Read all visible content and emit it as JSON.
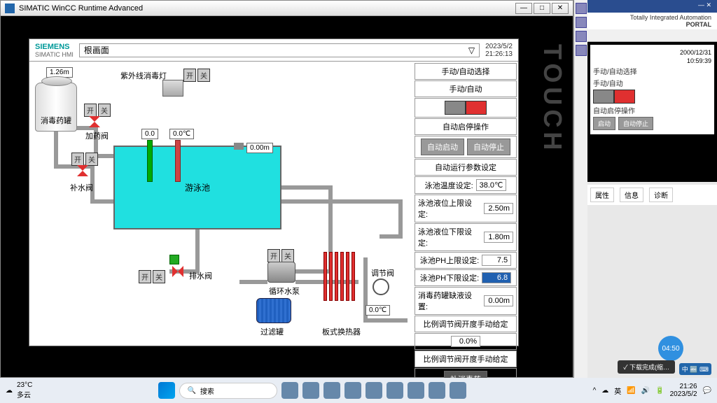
{
  "window": {
    "title": "SIMATIC WinCC Runtime Advanced"
  },
  "tia": {
    "title": "Totally Integrated Automation",
    "sub": "PORTAL",
    "date": "2000/12/31",
    "time": "10:59:39",
    "sel": "手动/自动选择",
    "mode": "手动/自动",
    "ops": "自动启停操作",
    "start": "启动",
    "stop": "自动停止",
    "tabs": {
      "prop": "属性",
      "info": "信息",
      "diag": "诊断"
    }
  },
  "hmi": {
    "brand": "SIEMENS",
    "sub": "SIMATIC HMI",
    "root": "根画面",
    "date": "2023/5/2",
    "time": "21:26:13"
  },
  "scada": {
    "tank_level": "1.26m",
    "tank_label": "消毒药罐",
    "uv": "紫外线消毒灯",
    "on": "开",
    "off": "关",
    "add_valve": "加药阀",
    "water_valve": "补水阀",
    "drain_valve": "排水阀",
    "pool": "游泳池",
    "sensor1": "0.0",
    "sensor2": "0.0℃",
    "level": "0.00m",
    "pump": "循环水泵",
    "filter": "过滤罐",
    "hx": "板式换热器",
    "reg_valve": "调节阀",
    "hx_temp": "0.0℃"
  },
  "panel": {
    "sel": "手动/自动选择",
    "mode": "手动/自动",
    "ops_hdr": "自动启停操作",
    "auto_start": "自动启动",
    "auto_stop": "自动停止",
    "params": "自动运行参数设定",
    "p1": {
      "lbl": "泳池温度设定:",
      "val": "38.0℃"
    },
    "p2": {
      "lbl": "泳池液位上限设定:",
      "val": "2.50m"
    },
    "p3": {
      "lbl": "泳池液位下限设定:",
      "val": "1.80m"
    },
    "p4": {
      "lbl": "泳池PH上限设定:",
      "val": "7.5"
    },
    "p5": {
      "lbl": "泳池PH下限设定:",
      "val": "6.8"
    },
    "p6": {
      "lbl": "消毒药罐缺液设置:",
      "val": "0.00m"
    },
    "p7": {
      "lbl": "比例调节阀开度手动给定"
    },
    "p7v": "0.0%",
    "p8": {
      "lbl": "比例调节阀开度手动给定"
    },
    "fill": "补消毒药"
  },
  "taskbar": {
    "temp": "23°C",
    "weather": "多云",
    "search": "搜索",
    "time": "21:26",
    "date": "2023/5/2",
    "notif": "下载完成(缩…"
  },
  "badge": "04:50",
  "ime": "中"
}
